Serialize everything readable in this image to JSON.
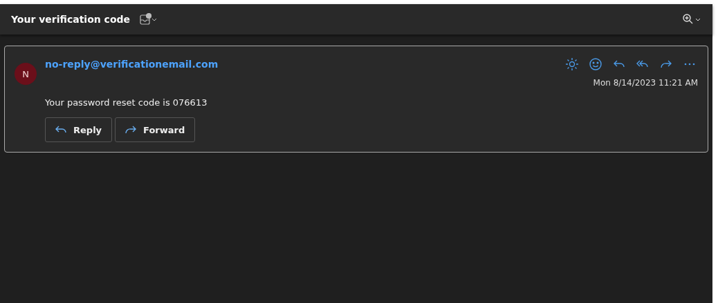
{
  "subject": {
    "title": "Your verification code"
  },
  "message": {
    "avatar": "N",
    "sender": "no-reply@verificationemail.com",
    "date": "Mon 8/14/2023 11:21 AM",
    "body": "Your password reset code is 076613",
    "buttons": [
      {
        "kind": "reply",
        "label": "Reply"
      },
      {
        "kind": "forward",
        "label": "Forward"
      }
    ]
  }
}
